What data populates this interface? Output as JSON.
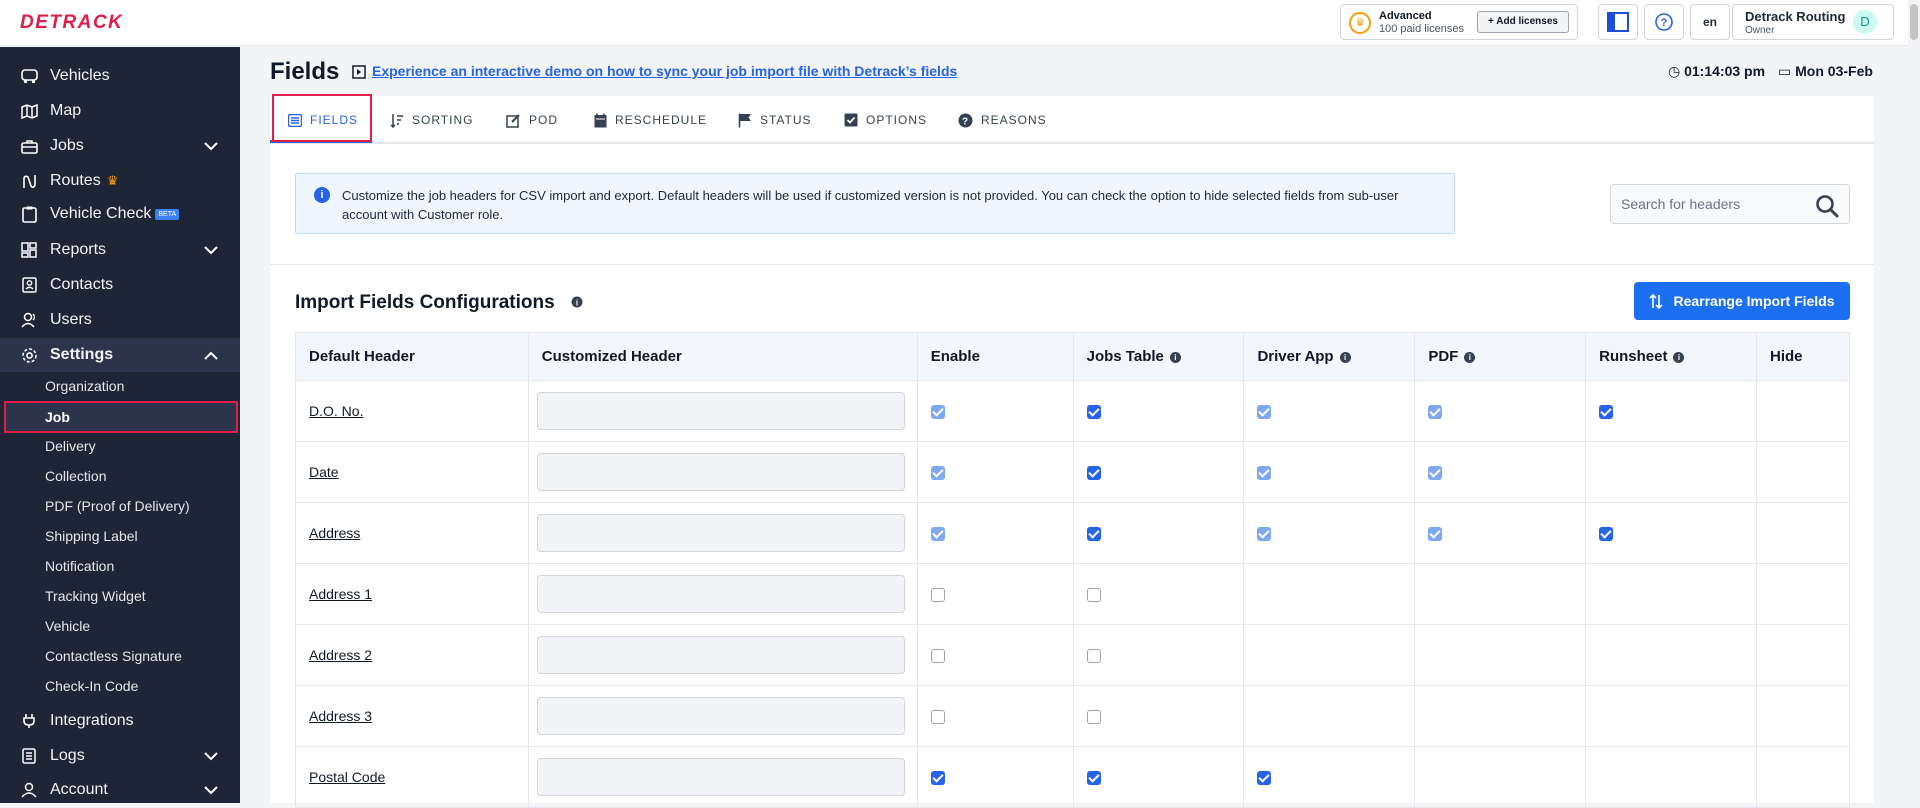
{
  "app": {
    "logo": "DETRACK"
  },
  "topbar": {
    "plan_title": "Advanced",
    "plan_sub": "100 paid licenses",
    "add_licenses": "+ Add licenses",
    "lang": "en",
    "user_name": "Detrack Routing",
    "user_role": "Owner",
    "avatar": "D"
  },
  "sidebar": {
    "items": [
      {
        "label": "Vehicles",
        "icon": "truck-icon"
      },
      {
        "label": "Map",
        "icon": "map-icon"
      },
      {
        "label": "Jobs",
        "icon": "briefcase-icon"
      },
      {
        "label": "Routes",
        "icon": "route-icon"
      },
      {
        "label": "Vehicle Check",
        "icon": "clipboard-icon",
        "badge": "BETA"
      },
      {
        "label": "Reports",
        "icon": "reports-icon"
      },
      {
        "label": "Contacts",
        "icon": "contacts-icon"
      },
      {
        "label": "Users",
        "icon": "users-icon"
      },
      {
        "label": "Settings",
        "icon": "gear-icon"
      }
    ],
    "settings_sub": [
      "Organization",
      "Job",
      "Delivery",
      "Collection",
      "PDF (Proof of Delivery)",
      "Shipping Label",
      "Notification",
      "Tracking Widget",
      "Vehicle",
      "Contactless Signature",
      "Check-In Code"
    ],
    "bottom_items": [
      {
        "label": "Integrations",
        "icon": "plug-icon"
      },
      {
        "label": "Logs",
        "icon": "logs-icon"
      },
      {
        "label": "Account",
        "icon": "account-icon"
      }
    ]
  },
  "header": {
    "title": "Fields",
    "demo_link": "Experience an interactive demo on how to sync your job import file with Detrack’s fields",
    "time": "01:14:03 pm",
    "date": "Mon 03-Feb"
  },
  "tabs": [
    "FIELDS",
    "SORTING",
    "POD",
    "RESCHEDULE",
    "STATUS",
    "OPTIONS",
    "REASONS"
  ],
  "info_text": "Customize the job headers for CSV import and export. Default headers will be used if customized version is not provided. You can check the option to hide selected fields from sub-user account with Customer role.",
  "search_placeholder": "Search for headers",
  "section_title": "Import Fields Configurations",
  "rearrange_button": "Rearrange Import Fields",
  "table": {
    "headers": [
      "Default Header",
      "Customized Header",
      "Enable",
      "Jobs Table",
      "Driver App",
      "PDF",
      "Runsheet",
      "Hide"
    ],
    "rows": [
      {
        "field": "D.O. No.",
        "enable": "disabled-checked",
        "jobs": "checked",
        "driver": "disabled-checked",
        "pdf": "disabled-checked",
        "runsheet": "checked"
      },
      {
        "field": "Date",
        "enable": "disabled-checked",
        "jobs": "checked",
        "driver": "disabled-checked",
        "pdf": "disabled-checked",
        "runsheet": "none"
      },
      {
        "field": "Address",
        "enable": "disabled-checked",
        "jobs": "checked",
        "driver": "disabled-checked",
        "pdf": "disabled-checked",
        "runsheet": "checked"
      },
      {
        "field": "Address 1",
        "enable": "unchecked",
        "jobs": "unchecked",
        "driver": "none",
        "pdf": "none",
        "runsheet": "none"
      },
      {
        "field": "Address 2",
        "enable": "unchecked",
        "jobs": "unchecked",
        "driver": "none",
        "pdf": "none",
        "runsheet": "none"
      },
      {
        "field": "Address 3",
        "enable": "unchecked",
        "jobs": "unchecked",
        "driver": "none",
        "pdf": "none",
        "runsheet": "none"
      },
      {
        "field": "Postal Code",
        "enable": "checked",
        "jobs": "checked",
        "driver": "checked",
        "pdf": "none",
        "runsheet": "none"
      }
    ]
  },
  "colors": {
    "accent": "#2563eb",
    "sidebar": "#1e2537",
    "highlight": "#e11d48"
  }
}
